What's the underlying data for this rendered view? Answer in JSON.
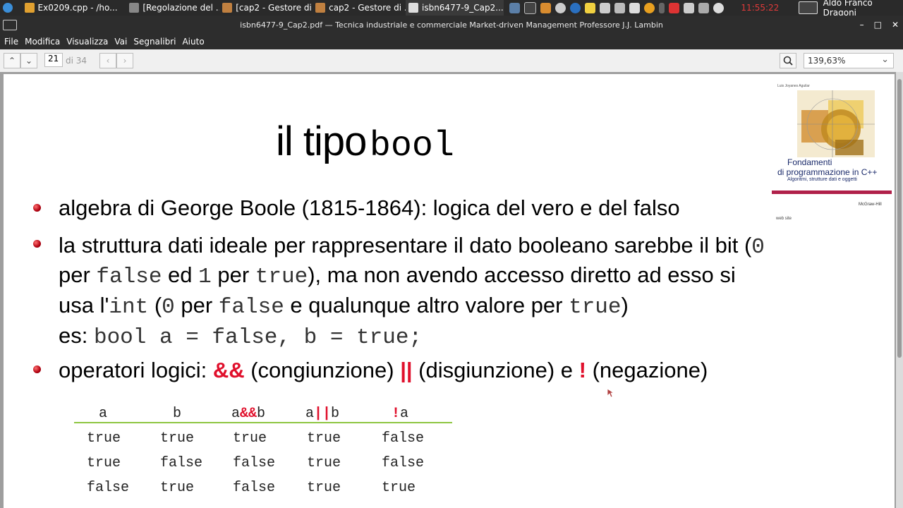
{
  "taskbar": {
    "tasks": [
      {
        "label": "Ex0209.cpp - /ho...",
        "icon": "editor-icon",
        "color": "#e0a030"
      },
      {
        "label": "[Regolazione del ...",
        "icon": "settings-icon",
        "color": "#888888"
      },
      {
        "label": "[cap2 - Gestore di...",
        "icon": "folder-icon",
        "color": "#c08040"
      },
      {
        "label": "cap2 - Gestore di ...",
        "icon": "folder-icon",
        "color": "#c08040"
      },
      {
        "label": "isbn6477-9_Cap2....",
        "icon": "pdf-icon",
        "color": "#dddddd"
      }
    ],
    "clock": "11:55:22",
    "user": "Aldo Franco Dragoni"
  },
  "window": {
    "title": "isbn6477-9_Cap2.pdf — Tecnica industriale e commerciale Market-driven Management Professore J.J. Lambin"
  },
  "menu": [
    "File",
    "Modifica",
    "Visualizza",
    "Vai",
    "Segnalibri",
    "Aiuto"
  ],
  "toolbar": {
    "page_current": "21",
    "page_total": "di 34",
    "zoom": "139,63%"
  },
  "slide": {
    "title_text": "il tipo",
    "title_code": "bool",
    "bullet1": "algebra di George Boole (1815-1864): logica del vero e del falso",
    "bullet2": {
      "l1a": "la struttura dati ideale per rappresentare il dato booleano sarebbe il bit (",
      "l1b": "0",
      "l2a": "per ",
      "l2b": "false",
      "l2c": " ed ",
      "l2d": "1",
      "l2e": " per ",
      "l2f": "true",
      "l2g": "), ma non avendo accesso diretto ad esso si",
      "l3a": "usa l'",
      "l3b": "int",
      "l3c": " (",
      "l3d": "0",
      "l3e": " per ",
      "l3f": "false",
      "l3g": " e qualunque altro valore per ",
      "l3h": "true",
      "l3i": ")",
      "l4a": "es: ",
      "l4b": "bool a = false, b = true;"
    },
    "bullet3": {
      "a": "operatori logici: ",
      "op_and": "&&",
      "b": " (congiunzione) ",
      "op_or": "||",
      "c": " (disgiunzione) e ",
      "op_not": "!",
      "d": " (negazione)"
    },
    "truth_table": {
      "headers": [
        "a",
        "b",
        "a&&b",
        "a||b",
        "!a"
      ],
      "rows": [
        [
          "true",
          "true",
          "true",
          "true",
          "false"
        ],
        [
          "true",
          "false",
          "false",
          "true",
          "false"
        ],
        [
          "false",
          "true",
          "false",
          "true",
          "true"
        ]
      ]
    },
    "cover": {
      "author": "Luis Joyanes Aguilar",
      "title_l1": "Fondamenti",
      "title_l2": "di programmazione in C++",
      "subtitle": "Algoritmi, strutture dati e oggetti",
      "publisher": "McGraw-Hill",
      "web": "web site"
    }
  }
}
